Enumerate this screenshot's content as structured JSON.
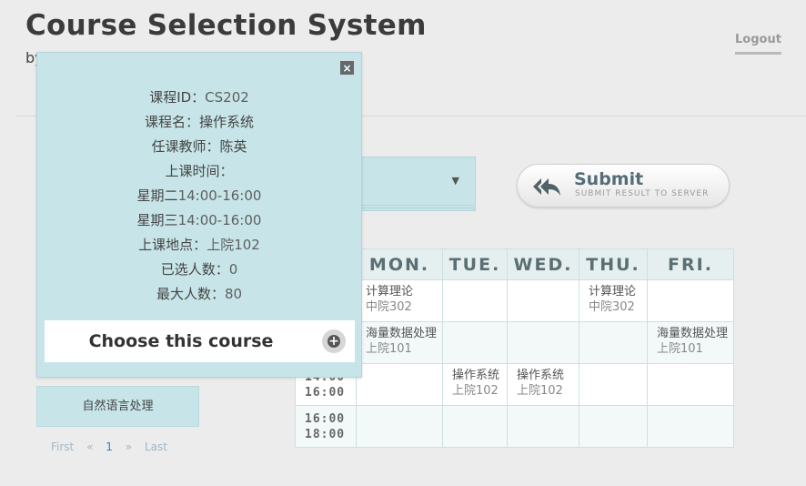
{
  "header": {
    "title": "Course Selection System",
    "subtitle": "by",
    "logout_label": "Logout"
  },
  "select": {
    "arrow": "▼"
  },
  "submit": {
    "label": "Submit",
    "sublabel": "SUBMIT RESULT TO SERVER",
    "icon": "reply-all-icon"
  },
  "timetable": {
    "days": [
      "MON.",
      "TUE.",
      "WED.",
      "THU.",
      "FRI."
    ],
    "rows": [
      {
        "time_start": "",
        "time_end": "",
        "cells": [
          {
            "course": "计算理论",
            "room": "中院302"
          },
          {
            "course": "",
            "room": ""
          },
          {
            "course": "",
            "room": ""
          },
          {
            "course": "计算理论",
            "room": "中院302"
          },
          {
            "course": "",
            "room": ""
          }
        ]
      },
      {
        "time_start": "",
        "time_end": "",
        "cells": [
          {
            "course": "海量数据处理",
            "room": "上院101"
          },
          {
            "course": "",
            "room": ""
          },
          {
            "course": "",
            "room": ""
          },
          {
            "course": "",
            "room": ""
          },
          {
            "course": "海量数据处理",
            "room": "上院101"
          }
        ]
      },
      {
        "time_start": "14:00",
        "time_end": "16:00",
        "cells": [
          {
            "course": "",
            "room": ""
          },
          {
            "course": "操作系统",
            "room": "上院102"
          },
          {
            "course": "操作系统",
            "room": "上院102"
          },
          {
            "course": "",
            "room": ""
          },
          {
            "course": "",
            "room": ""
          }
        ]
      },
      {
        "time_start": "16:00",
        "time_end": "18:00",
        "cells": [
          {
            "course": "",
            "room": ""
          },
          {
            "course": "",
            "room": ""
          },
          {
            "course": "",
            "room": ""
          },
          {
            "course": "",
            "room": ""
          },
          {
            "course": "",
            "room": ""
          }
        ]
      }
    ]
  },
  "course_list": [
    {
      "name": "自然语言处理"
    }
  ],
  "pager": {
    "first": "First",
    "prev": "«",
    "current": "1",
    "next": "»",
    "last": "Last"
  },
  "popover": {
    "close": "×",
    "id_label": "课程ID：",
    "id_value": "CS202",
    "name_label": "课程名：",
    "name_value": "操作系统",
    "teacher_label": "任课教师：",
    "teacher_value": "陈英",
    "time_label": "上课时间：",
    "time_1_day": "星期二",
    "time_1_range": "14:00-16:00",
    "time_2_day": "星期三",
    "time_2_range": "14:00-16:00",
    "location_label": "上课地点：",
    "location_value": "上院102",
    "enrolled_label": "已选人数：",
    "enrolled_value": "0",
    "max_label": "最大人数：",
    "max_value": "80",
    "choose_label": "Choose this course"
  }
}
